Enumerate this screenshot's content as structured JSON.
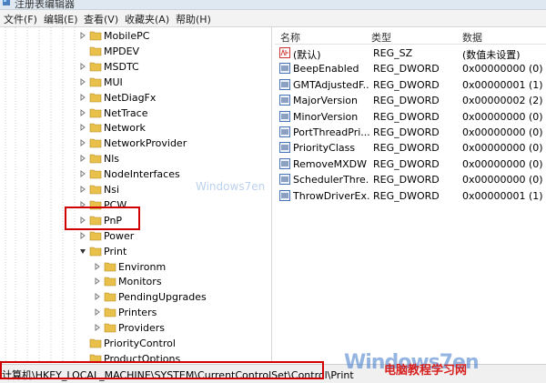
{
  "window": {
    "title": "注册表编辑器"
  },
  "menu": [
    "文件(F)",
    "编辑(E)",
    "查看(V)",
    "收藏夹(A)",
    "帮助(H)"
  ],
  "tree": {
    "items": [
      {
        "label": "MobilePC",
        "arrow": "right",
        "indent": 0
      },
      {
        "label": "MPDEV",
        "arrow": "none",
        "indent": 0
      },
      {
        "label": "MSDTC",
        "arrow": "right",
        "indent": 0
      },
      {
        "label": "MUI",
        "arrow": "right",
        "indent": 0
      },
      {
        "label": "NetDiagFx",
        "arrow": "right",
        "indent": 0
      },
      {
        "label": "NetTrace",
        "arrow": "right",
        "indent": 0
      },
      {
        "label": "Network",
        "arrow": "right",
        "indent": 0
      },
      {
        "label": "NetworkProvider",
        "arrow": "right",
        "indent": 0
      },
      {
        "label": "Nls",
        "arrow": "right",
        "indent": 0
      },
      {
        "label": "NodeInterfaces",
        "arrow": "right",
        "indent": 0
      },
      {
        "label": "Nsi",
        "arrow": "right",
        "indent": 0
      },
      {
        "label": "PCW",
        "arrow": "right",
        "indent": 0
      },
      {
        "label": "PnP",
        "arrow": "right",
        "indent": 0
      },
      {
        "label": "Power",
        "arrow": "right",
        "indent": 0
      },
      {
        "label": "Print",
        "arrow": "down",
        "indent": 0
      },
      {
        "label": "Environm",
        "arrow": "right",
        "indent": 1
      },
      {
        "label": "Monitors",
        "arrow": "right",
        "indent": 1
      },
      {
        "label": "PendingUpgrades",
        "arrow": "right",
        "indent": 1
      },
      {
        "label": "Printers",
        "arrow": "right",
        "indent": 1
      },
      {
        "label": "Providers",
        "arrow": "right",
        "indent": 1
      },
      {
        "label": "PriorityControl",
        "arrow": "none",
        "indent": 0
      },
      {
        "label": "ProductOptions",
        "arrow": "none",
        "indent": 0
      }
    ]
  },
  "list": {
    "columns": [
      "名称",
      "类型",
      "数据"
    ],
    "rows": [
      {
        "icon": "ab",
        "name": "(默认)",
        "type": "REG_SZ",
        "data": "(数值未设置)"
      },
      {
        "icon": "bin",
        "name": "BeepEnabled",
        "type": "REG_DWORD",
        "data": "0x00000000 (0)"
      },
      {
        "icon": "bin",
        "name": "GMTAdjustedF...",
        "type": "REG_DWORD",
        "data": "0x00000001 (1)"
      },
      {
        "icon": "bin",
        "name": "MajorVersion",
        "type": "REG_DWORD",
        "data": "0x00000002 (2)"
      },
      {
        "icon": "bin",
        "name": "MinorVersion",
        "type": "REG_DWORD",
        "data": "0x00000000 (0)"
      },
      {
        "icon": "bin",
        "name": "PortThreadPri...",
        "type": "REG_DWORD",
        "data": "0x00000000 (0)"
      },
      {
        "icon": "bin",
        "name": "PriorityClass",
        "type": "REG_DWORD",
        "data": "0x00000000 (0)"
      },
      {
        "icon": "bin",
        "name": "RemoveMXDW",
        "type": "REG_DWORD",
        "data": "0x00000000 (0)"
      },
      {
        "icon": "bin",
        "name": "SchedulerThre...",
        "type": "REG_DWORD",
        "data": "0x00000000 (0)"
      },
      {
        "icon": "bin",
        "name": "ThrowDriverEx...",
        "type": "REG_DWORD",
        "data": "0x00000001 (1)"
      }
    ]
  },
  "status": {
    "path": "计算机\\HKEY_LOCAL_MACHINE\\SYSTEM\\CurrentControlSet\\Control\\Print"
  },
  "watermark": {
    "brand": "Windows7en",
    "cn": "电脑教程学习网"
  },
  "colors": {
    "highlight": "#d10000",
    "folder": "#e8c04a"
  }
}
